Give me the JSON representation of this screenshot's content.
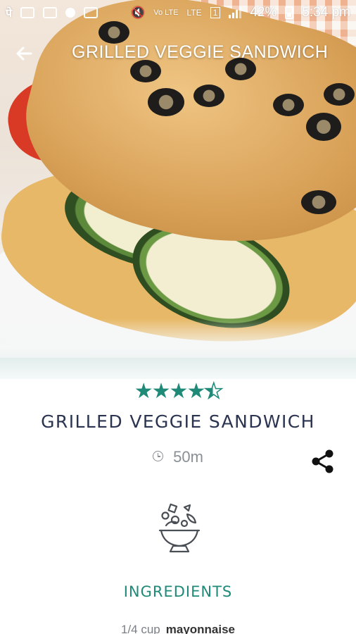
{
  "status_bar": {
    "battery": "42%",
    "time": "5:34 pm",
    "network": "LTE",
    "volte": "Vo LTE",
    "sim": "1"
  },
  "app_bar": {
    "title": "GRILLED VEGGIE SANDWICH"
  },
  "recipe": {
    "rating": 4.5,
    "title": "GRILLED VEGGIE SANDWICH",
    "time": "50m"
  },
  "ingredients": {
    "section_title": "INGREDIENTS",
    "items": [
      {
        "quantity": "1/4 cup",
        "name": "mayonnaise"
      }
    ]
  },
  "colors": {
    "accent": "#1f8a78",
    "title_text": "#2b3551",
    "muted_text": "#8a8f94"
  }
}
